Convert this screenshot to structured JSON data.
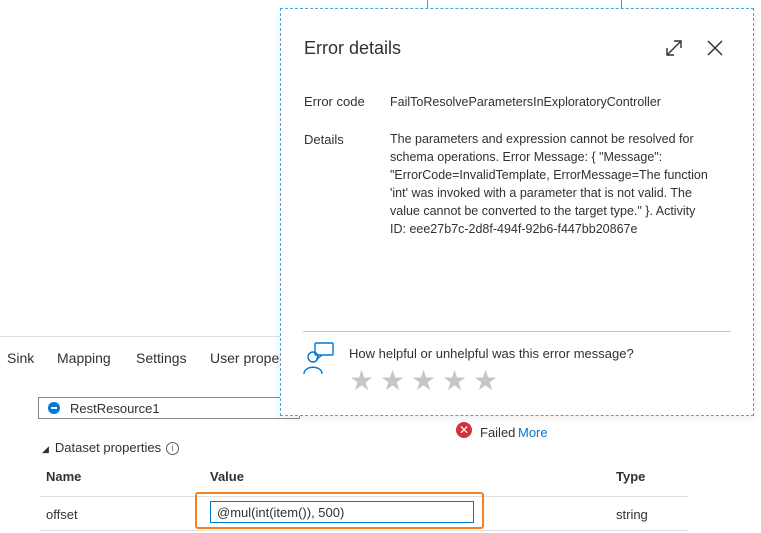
{
  "tabs": [
    "Sink",
    "Mapping",
    "Settings",
    "User prope"
  ],
  "dataset": {
    "selected": "RestResource1"
  },
  "status": {
    "text": "Failed",
    "link": "More"
  },
  "dataset_properties": {
    "heading": "Dataset properties",
    "columns": {
      "name": "Name",
      "value": "Value",
      "type": "Type"
    },
    "rows": [
      {
        "name": "offset",
        "value": "@mul(int(item()), 500)",
        "type": "string"
      }
    ]
  },
  "error_dialog": {
    "title": "Error details",
    "error_code_label": "Error code",
    "error_code": "FailToResolveParametersInExploratoryController",
    "details_label": "Details",
    "details_lines": [
      "The parameters and expression cannot be resolved for",
      "schema operations. Error Message: { \"Message\":",
      "\"ErrorCode=InvalidTemplate, ErrorMessage=The function",
      "'int' was invoked with a parameter that is not valid. The",
      "value cannot be converted to the target type.\" }. Activity",
      "ID: eee27b7c-2d8f-494f-92b6-f447bb20867e"
    ],
    "feedback_question": "How helpful or unhelpful was this error message?",
    "rating_max": 5,
    "rating_selected": 0
  },
  "colors": {
    "accent": "#0078d4",
    "error": "#d13438",
    "highlight": "#f4801f"
  }
}
